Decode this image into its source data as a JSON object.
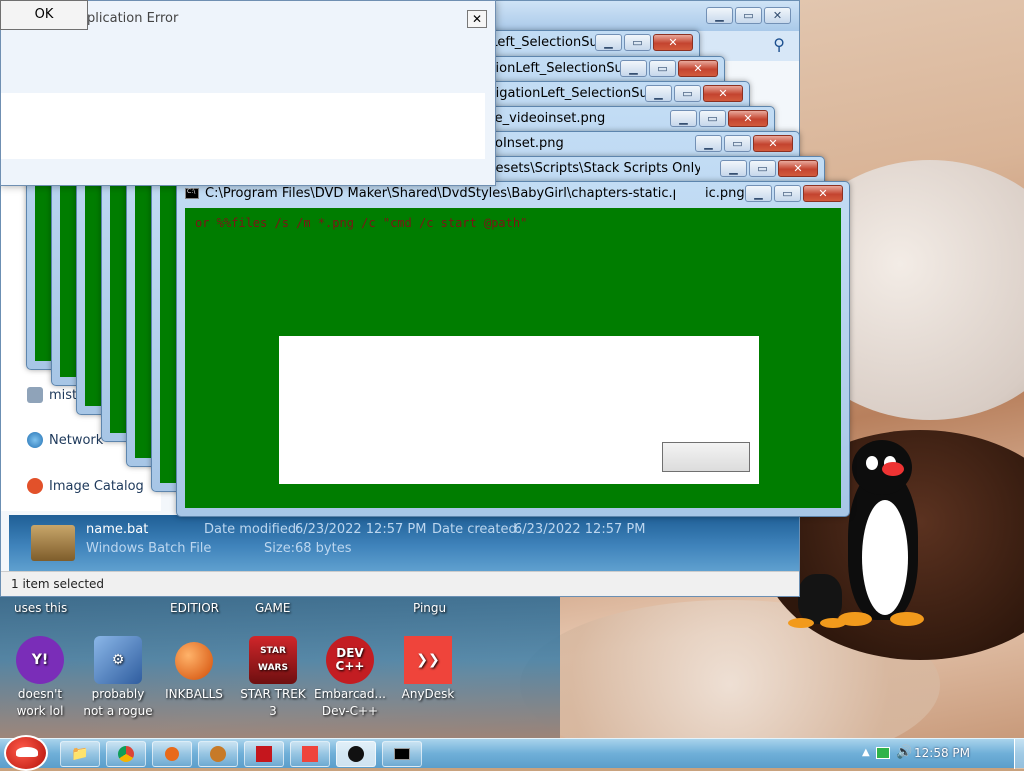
{
  "error_dialog": {
    "title": "plication Error",
    "ok_label": "OK",
    "close_glyph": "✕"
  },
  "cmd_windows": [
    {
      "title": "C:\\Program Files\\DVD Maker\\Shared\\DvdStyles\\FlipPage\\NavigationLeft_SelectionSubpictu..."
    },
    {
      "title": "C:\\Program Files\\DVD Maker\\Shared\\DvdStyles\\FlipPage\\NavigationLeft_SelectionSubpictu..."
    },
    {
      "title": "C:\\Program Files\\DVD Maker\\Shared\\DvdStyles\\FlipPage\\NavigationLeft_SelectionSubpictu..."
    },
    {
      "title": "me_videoinset.png"
    },
    {
      "title": "eoInset.png"
    },
    {
      "title": "C:\\Program Files\\Adobe\\Adobe Photoshop CS6\\Presets\\Scripts\\Stack Scripts Only\\P_Aut"
    },
    {
      "title": "C:\\Program Files\\DVD Maker\\Shared\\DvdStyles\\BabyGirl\\chapters-static.png"
    },
    {
      "title": "ic.png"
    }
  ],
  "cmd_command": "or %%files /s /m *.png /c \"cmd /c start @path\"",
  "window_buttons": {
    "minimize": "▁",
    "maximize": "▭",
    "close": "✕"
  },
  "explorer": {
    "left_truncated": "F",
    "sidebar": [
      {
        "label": "mist",
        "icon": "computer-icon"
      },
      {
        "label": "Network",
        "icon": "network-icon"
      },
      {
        "label": "Image Catalog",
        "icon": "image-catalog-icon"
      }
    ],
    "details": {
      "file_name": "name.bat",
      "file_type": "Windows Batch File",
      "modified_label": "Date modified:",
      "modified_value": "6/23/2022 12:57 PM",
      "created_label": "Date created:",
      "created_value": "6/23/2022 12:57 PM",
      "size_label": "Size:",
      "size_value": "68 bytes"
    },
    "status": "1 item selected"
  },
  "desktop": {
    "group_labels": [
      "uses this",
      "EDITIOR",
      "GAME",
      "Pingu"
    ],
    "icons": [
      {
        "label": "doesn't work lol",
        "icon": "yahoo-messenger-icon",
        "color": "#6b1fa0"
      },
      {
        "label": "probably not a rogue",
        "icon": "settings-gears-icon",
        "color": "#4b7fc4"
      },
      {
        "label": "INKBALLS",
        "icon": "inkball-icon",
        "color": "#e86a1a"
      },
      {
        "label": "STAR TREK 3",
        "icon": "angry-birds-star-wars-icon",
        "color": "#a8191c"
      },
      {
        "label": "Embarcad... Dev-C++",
        "icon": "dev-cpp-icon",
        "color": "#c31d22"
      },
      {
        "label": "AnyDesk",
        "icon": "anydesk-icon",
        "color": "#ef443b"
      }
    ]
  },
  "taskbar": {
    "clock": "12:58 PM",
    "buttons": [
      "explorer-icon",
      "chrome-icon",
      "inkball-icon",
      "apps-icon",
      "acrobat-icon",
      "anydesk-icon",
      "pingu-icon",
      "cmd-icon"
    ]
  }
}
